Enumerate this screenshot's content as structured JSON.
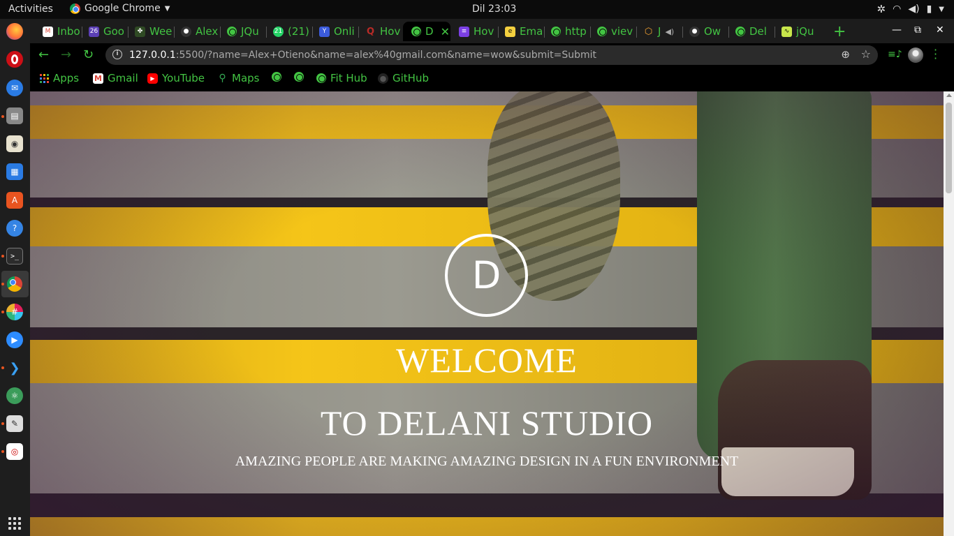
{
  "topbar": {
    "activities": "Activities",
    "app_name": "Google Chrome",
    "clock": "Dil 23:03"
  },
  "tabs": [
    {
      "label": "Inbo",
      "icon": "gmail-icon",
      "color": "#db4437"
    },
    {
      "label": "Goo",
      "icon": "calendar-icon",
      "color": "#5b3fb5"
    },
    {
      "label": "Wee",
      "icon": "tree-icon",
      "color": "#3a6e2f"
    },
    {
      "label": "Alex",
      "icon": "github-icon",
      "color": "#333333"
    },
    {
      "label": "JQu",
      "icon": "globe-icon",
      "color": "#43c443"
    },
    {
      "label": "(21)",
      "icon": "whatsapp-icon",
      "color": "#25d366"
    },
    {
      "label": "Onli",
      "icon": "shield-icon",
      "color": "#3b5bdb"
    },
    {
      "label": "Hov",
      "icon": "quora-icon",
      "color": "#b92b27"
    },
    {
      "label": "D",
      "icon": "globe-icon",
      "color": "#43c443"
    },
    {
      "label": "Hov",
      "icon": "doc-icon",
      "color": "#7b3fe4"
    },
    {
      "label": "Ema",
      "icon": "email-icon",
      "color": "#f4d03f"
    },
    {
      "label": "http",
      "icon": "globe-icon",
      "color": "#43c443"
    },
    {
      "label": "viev",
      "icon": "globe-icon",
      "color": "#43c443"
    },
    {
      "label": "J",
      "icon": "cube-icon",
      "color": "#f0a030"
    },
    {
      "label": "Ow",
      "icon": "github-icon",
      "color": "#333333"
    },
    {
      "label": "Del",
      "icon": "globe-icon",
      "color": "#43c443"
    },
    {
      "label": "jQu",
      "icon": "chart-icon",
      "color": "#c8e64b"
    }
  ],
  "toolbar": {
    "url_host": "127.0.0.1",
    "url_rest": ":5500/?name=Alex+Otieno&name=alex%40gmail.com&name=wow&submit=Submit"
  },
  "bookmarks": [
    {
      "label": "Apps",
      "icon": "apps-icon"
    },
    {
      "label": "Gmail",
      "icon": "gmail-icon"
    },
    {
      "label": "YouTube",
      "icon": "youtube-icon"
    },
    {
      "label": "Maps",
      "icon": "maps-icon"
    },
    {
      "label": "",
      "icon": "globe-icon"
    },
    {
      "label": "",
      "icon": "globe-icon"
    },
    {
      "label": "Fit Hub",
      "icon": "globe-icon"
    },
    {
      "label": "GitHub",
      "icon": "github-icon"
    }
  ],
  "hero": {
    "logo_letter": "D",
    "welcome": "WELCOME",
    "studio": "TO DELANI STUDIO",
    "tagline": "AMAZING PEOPLE ARE MAKING AMAZING DESIGN IN A FUN ENVIRONMENT"
  },
  "colors": {
    "accent_green": "#43c443",
    "stair_yellow": "#f5c518"
  }
}
